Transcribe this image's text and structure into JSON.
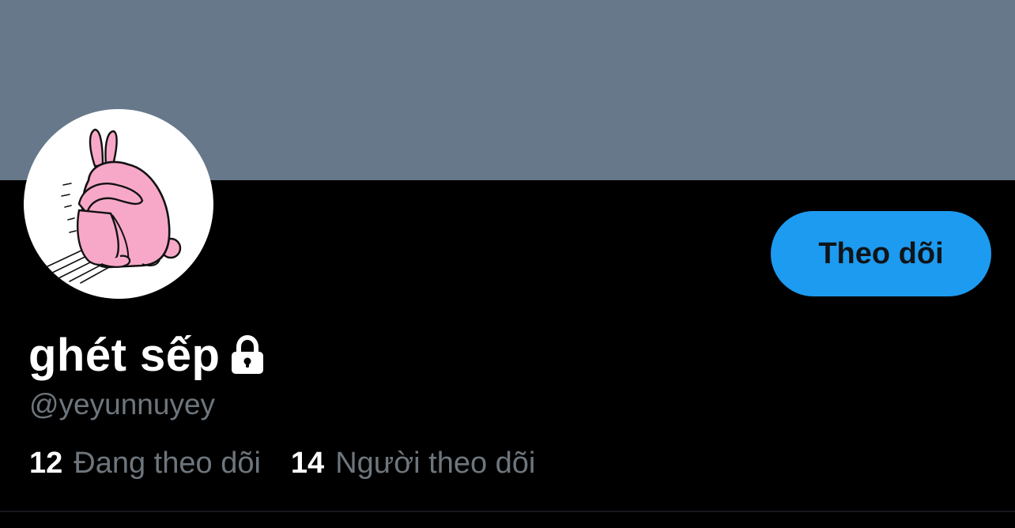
{
  "profile": {
    "display_name": "ghét sếp",
    "handle": "@yeyunnuyey",
    "protected": true,
    "avatar_icon": "pink-rabbit-avatar"
  },
  "actions": {
    "follow_label": "Theo dõi"
  },
  "stats": {
    "following_count": "12",
    "following_label": "Đang theo dõi",
    "followers_count": "14",
    "followers_label": "Người theo dõi"
  },
  "colors": {
    "banner": "#66788a",
    "background": "#000000",
    "accent": "#1d9bf0",
    "secondary_text": "#6e767d"
  }
}
